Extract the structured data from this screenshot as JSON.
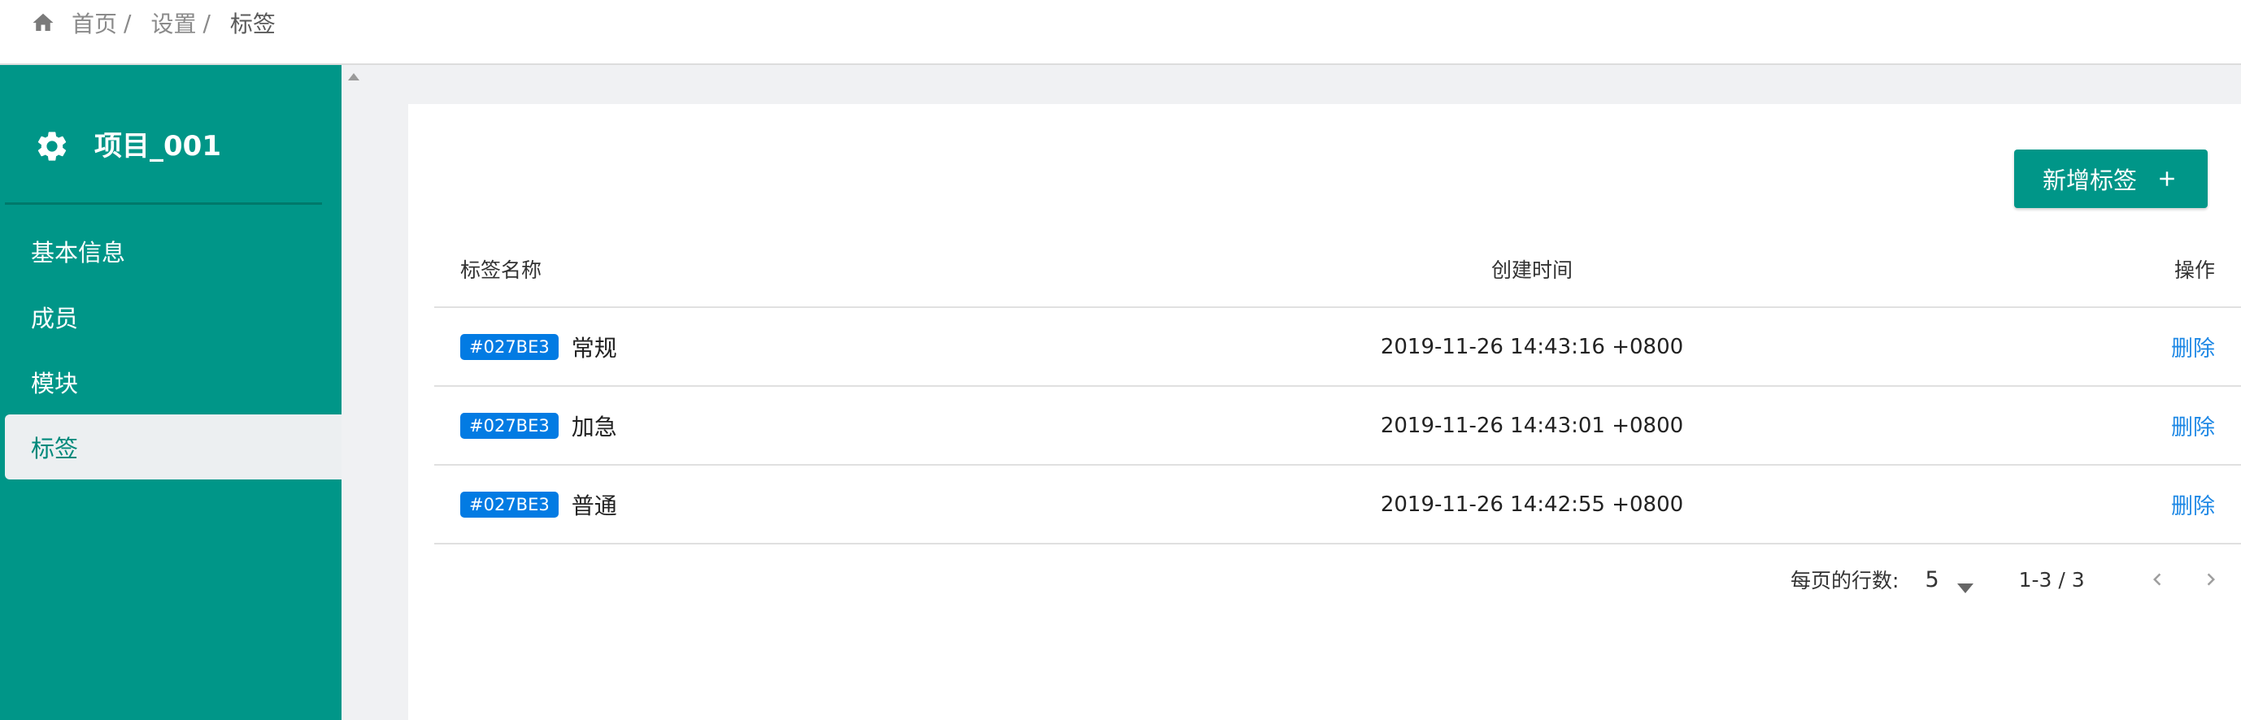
{
  "breadcrumb": {
    "items": [
      "首页",
      "设置",
      "标签"
    ],
    "separator": "/"
  },
  "sidebar": {
    "project_title": "项目_001",
    "items": [
      {
        "label": "基本信息"
      },
      {
        "label": "成员"
      },
      {
        "label": "模块"
      },
      {
        "label": "标签",
        "active": true
      }
    ]
  },
  "toolbar": {
    "add_label": "新增标签"
  },
  "table": {
    "columns": [
      "标签名称",
      "创建时间",
      "操作"
    ],
    "rows": [
      {
        "tag_color": "#027BE3",
        "name": "常规",
        "created": "2019-11-26 14:43:16 +0800",
        "action": "删除"
      },
      {
        "tag_color": "#027BE3",
        "name": "加急",
        "created": "2019-11-26 14:43:01 +0800",
        "action": "删除"
      },
      {
        "tag_color": "#027BE3",
        "name": "普通",
        "created": "2019-11-26 14:42:55 +0800",
        "action": "删除"
      }
    ]
  },
  "pagination": {
    "rows_per_page_label": "每页的行数:",
    "rows_per_page": "5",
    "range": "1-3 / 3"
  },
  "colors": {
    "primary": "#009688",
    "tag_chip": "#027BE3",
    "link": "#1e88e5"
  }
}
